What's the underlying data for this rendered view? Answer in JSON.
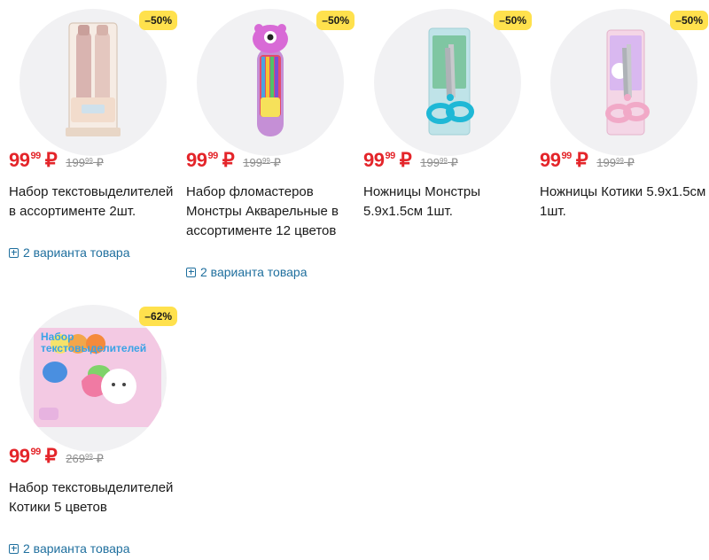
{
  "products": [
    {
      "discount": "–50%",
      "price": {
        "rub": "99",
        "kop": "99",
        "currency": "₽"
      },
      "old_price": {
        "rub": "199",
        "kop": "99",
        "currency": "₽"
      },
      "title": "Набор текстовыделителей в ассортименте 2шт.",
      "variants": "2 варианта товара",
      "image_icon": "highlighter-set-image"
    },
    {
      "discount": "–50%",
      "price": {
        "rub": "99",
        "kop": "99",
        "currency": "₽"
      },
      "old_price": {
        "rub": "199",
        "kop": "99",
        "currency": "₽"
      },
      "title": "Набор фломастеров Монстры Акварельные в ассортименте 12 цветов",
      "variants": "2 варианта товара",
      "image_icon": "marker-tube-image"
    },
    {
      "discount": "–50%",
      "price": {
        "rub": "99",
        "kop": "99",
        "currency": "₽"
      },
      "old_price": {
        "rub": "199",
        "kop": "99",
        "currency": "₽"
      },
      "title": "Ножницы Монстры 5.9x1.5см 1шт.",
      "image_icon": "scissors-blue-image"
    },
    {
      "discount": "–50%",
      "price": {
        "rub": "99",
        "kop": "99",
        "currency": "₽"
      },
      "old_price": {
        "rub": "199",
        "kop": "99",
        "currency": "₽"
      },
      "title": "Ножницы Котики 5.9x1.5см 1шт.",
      "image_icon": "scissors-pink-image"
    },
    {
      "discount": "–62%",
      "price": {
        "rub": "99",
        "kop": "99",
        "currency": "₽"
      },
      "old_price": {
        "rub": "269",
        "kop": "99",
        "currency": "₽"
      },
      "title": "Набор текстовыделителей Котики 5 цветов",
      "variants": "2 варианта товара",
      "image_icon": "highlighter-cats-image",
      "image_text": "Набор текстовыделителей"
    }
  ],
  "colors": {
    "price": "#e4252a",
    "badge": "#ffe14d",
    "link": "#1f6f9e",
    "old_price": "#8e8e8e"
  }
}
